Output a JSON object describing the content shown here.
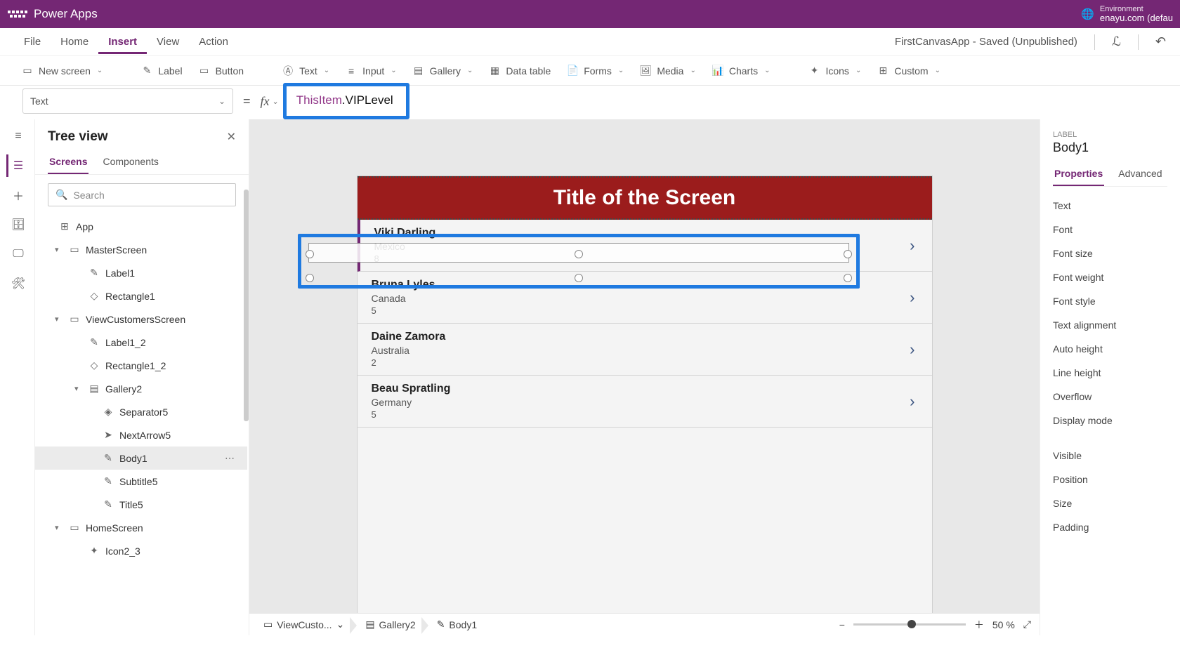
{
  "topbar": {
    "app": "Power Apps",
    "env_small": "Environment",
    "env": "enayu.com (defau"
  },
  "menu": {
    "items": [
      "File",
      "Home",
      "Insert",
      "View",
      "Action"
    ],
    "active": 2,
    "status": "FirstCanvasApp - Saved (Unpublished)"
  },
  "ribbon": [
    {
      "label": "New screen",
      "icon": "▭",
      "chev": true
    },
    {
      "label": "Label",
      "icon": "✎"
    },
    {
      "label": "Button",
      "icon": "▭"
    },
    {
      "label": "Text",
      "icon": "Ⓐ",
      "chev": true
    },
    {
      "label": "Input",
      "icon": "≡",
      "chev": true
    },
    {
      "label": "Gallery",
      "icon": "▤",
      "chev": true
    },
    {
      "label": "Data table",
      "icon": "▦"
    },
    {
      "label": "Forms",
      "icon": "📄",
      "chev": true
    },
    {
      "label": "Media",
      "icon": "🖼",
      "chev": true
    },
    {
      "label": "Charts",
      "icon": "📊",
      "chev": true
    },
    {
      "label": "Icons",
      "icon": "✦",
      "chev": true
    },
    {
      "label": "Custom",
      "icon": "⊞",
      "chev": true
    }
  ],
  "formula": {
    "property": "Text",
    "obj": "ThisItem",
    "prop": ".VIPLevel"
  },
  "tree": {
    "title": "Tree view",
    "tabs": [
      "Screens",
      "Components"
    ],
    "active_tab": 0,
    "search_placeholder": "Search",
    "nodes": [
      {
        "l": 1,
        "icon": "app",
        "label": "App"
      },
      {
        "l": 2,
        "caret": "▾",
        "icon": "screen",
        "label": "MasterScreen"
      },
      {
        "l": 3,
        "icon": "label",
        "label": "Label1"
      },
      {
        "l": 3,
        "icon": "rect",
        "label": "Rectangle1"
      },
      {
        "l": 2,
        "caret": "▾",
        "icon": "screen",
        "label": "ViewCustomersScreen"
      },
      {
        "l": 3,
        "icon": "label",
        "label": "Label1_2"
      },
      {
        "l": 3,
        "icon": "rect",
        "label": "Rectangle1_2"
      },
      {
        "l": 3,
        "caret": "▾",
        "icon": "gallery",
        "label": "Gallery2"
      },
      {
        "l": 4,
        "icon": "sep",
        "label": "Separator5"
      },
      {
        "l": 4,
        "icon": "arrow",
        "label": "NextArrow5"
      },
      {
        "l": 4,
        "icon": "label",
        "label": "Body1",
        "sel": true,
        "dots": true
      },
      {
        "l": 4,
        "icon": "label",
        "label": "Subtitle5"
      },
      {
        "l": 4,
        "icon": "label",
        "label": "Title5"
      },
      {
        "l": 2,
        "caret": "▾",
        "icon": "screen",
        "label": "HomeScreen"
      },
      {
        "l": 3,
        "icon": "iconset",
        "label": "Icon2_3"
      }
    ]
  },
  "canvas": {
    "title": "Title of the Screen",
    "rows": [
      {
        "name": "Viki  Darling",
        "sub": "Mexico",
        "vip": "8"
      },
      {
        "name": "Bruna  Lyles",
        "sub": "Canada",
        "vip": "5"
      },
      {
        "name": "Daine  Zamora",
        "sub": "Australia",
        "vip": "2"
      },
      {
        "name": "Beau  Spratling",
        "sub": "Germany",
        "vip": "5"
      }
    ]
  },
  "breadcrumb": [
    {
      "icon": "▭",
      "label": "ViewCusto...",
      "chev": true
    },
    {
      "icon": "▤",
      "label": "Gallery2"
    },
    {
      "icon": "✎",
      "label": "Body1"
    }
  ],
  "zoom": {
    "value": "50",
    "unit": "%"
  },
  "props": {
    "small": "LABEL",
    "name": "Body1",
    "tabs": [
      "Properties",
      "Advanced"
    ],
    "active": 0,
    "rows": [
      "Text",
      "Font",
      "Font size",
      "Font weight",
      "Font style",
      "Text alignment",
      "Auto height",
      "Line height",
      "Overflow",
      "Display mode"
    ],
    "rows2": [
      "Visible",
      "Position",
      "Size",
      "Padding"
    ]
  }
}
